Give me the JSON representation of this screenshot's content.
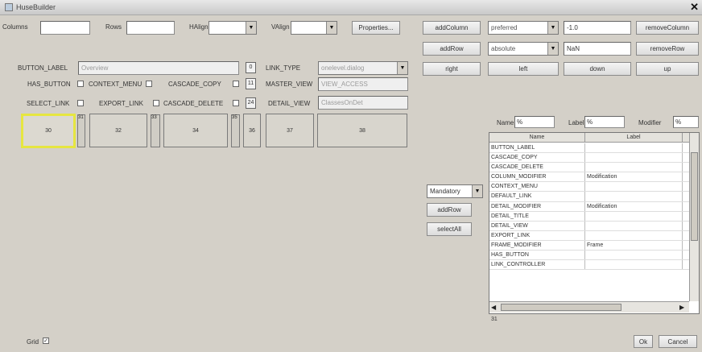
{
  "window": {
    "title": "HuseBuilder"
  },
  "top": {
    "columns_label": "Columns",
    "rows_label": "Rows",
    "halign_label": "HAlign",
    "valign_label": "VAlign",
    "properties_button": "Properties..."
  },
  "layout_panel": {
    "add_column": "addColumn",
    "add_row": "addRow",
    "right": "right",
    "left": "left",
    "down": "down",
    "up": "up",
    "remove_column": "removeColumn",
    "remove_row": "removeRow",
    "col_size_mode": "preferred",
    "col_size_value": "-1.0",
    "row_size_mode": "absolute",
    "row_size_value": "NaN"
  },
  "form": {
    "button_label_label": "BUTTON_LABEL",
    "button_label_value": "Overview",
    "link_type_label": "LINK_TYPE",
    "link_type_value": "onelevel.dialog",
    "has_button_label": "HAS_BUTTON",
    "context_menu_label": "CONTEXT_MENU",
    "cascade_copy_label": "CASCADE_COPY",
    "master_view_label": "MASTER_VIEW",
    "master_view_value": "VIEW_ACCESS",
    "select_link_label": "SELECT_LINK",
    "export_link_label": "EXPORT_LINK",
    "cascade_delete_label": "CASCADE_DELETE",
    "detail_view_label": "DETAIL_VIEW",
    "detail_view_value": "ClassesOnDet",
    "num_a": "0",
    "num_b": "11",
    "num_c": "24"
  },
  "grid_cells": [
    "30",
    "31",
    "32",
    "33",
    "34",
    "35",
    "36",
    "37",
    "38"
  ],
  "middle": {
    "mode_select": "Mandatory",
    "add_row_button": "addRow",
    "select_all_button": "selectAll"
  },
  "filters": {
    "name_label": "Name",
    "name_value": "%",
    "label_label": "Label",
    "label_value": "%",
    "modifier_label": "Modifier",
    "modifier_value": "%"
  },
  "table": {
    "columns": [
      "Name",
      "Label"
    ],
    "rows": [
      [
        "BUTTON_LABEL",
        ""
      ],
      [
        "CASCADE_COPY",
        ""
      ],
      [
        "CASCADE_DELETE",
        ""
      ],
      [
        "COLUMN_MODIFIER",
        "Modification"
      ],
      [
        "CONTEXT_MENU",
        ""
      ],
      [
        "DEFAULT_LINK",
        ""
      ],
      [
        "DETAIL_MODIFIER",
        "Modification"
      ],
      [
        "DETAIL_TITLE",
        ""
      ],
      [
        "DETAIL_VIEW",
        ""
      ],
      [
        "EXPORT_LINK",
        ""
      ],
      [
        "FRAME_MODIFIER",
        "Frame"
      ],
      [
        "HAS_BUTTON",
        ""
      ],
      [
        "LINK_CONTROLLER",
        ""
      ]
    ],
    "count": "31"
  },
  "footer": {
    "grid_label": "Grid",
    "ok_button": "Ok",
    "cancel_button": "Cancel"
  }
}
